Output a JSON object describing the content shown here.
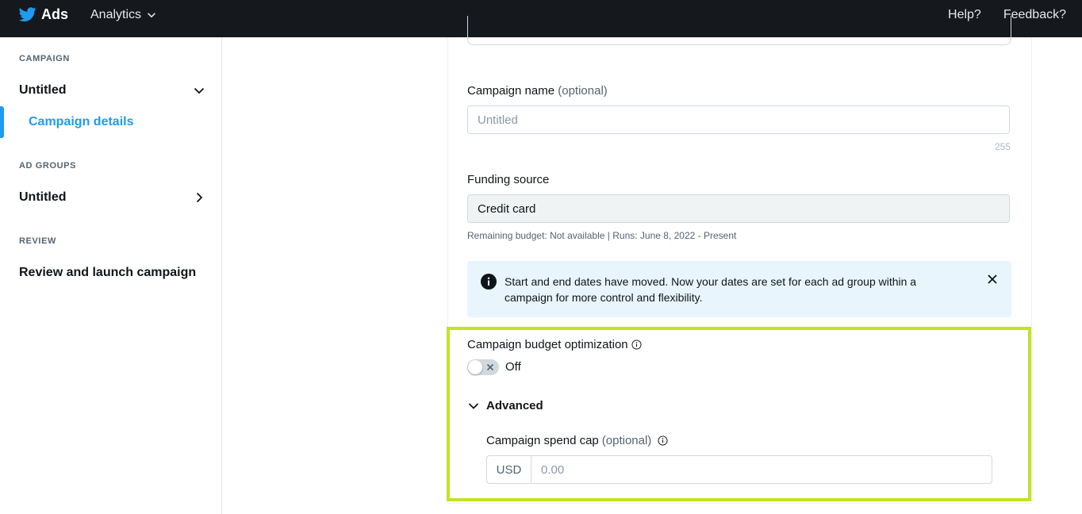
{
  "topbar": {
    "brand": "Ads",
    "analytics_label": "Analytics",
    "help_label": "Help?",
    "feedback_label": "Feedback?"
  },
  "sidebar": {
    "campaign_section": "CAMPAIGN",
    "campaign_name": "Untitled",
    "campaign_details": "Campaign details",
    "ad_groups_section": "AD GROUPS",
    "ad_group_name": "Untitled",
    "review_section": "REVIEW",
    "review_link": "Review and launch campaign"
  },
  "form": {
    "campaign_name_label": "Campaign name",
    "campaign_name_optional": "(optional)",
    "campaign_name_placeholder": "Untitled",
    "campaign_name_counter": "255",
    "funding_source_label": "Funding source",
    "funding_source_value": "Credit card",
    "funding_hint": "Remaining budget: Not available | Runs: June 8, 2022 - Present",
    "info_message": "Start and end dates have moved. Now your dates are set for each ad group within a campaign for more control and flexibility.",
    "cbo_label": "Campaign budget optimization",
    "cbo_state": "Off",
    "advanced_label": "Advanced",
    "spend_cap_label": "Campaign spend cap",
    "spend_cap_optional": "(optional)",
    "currency": "USD",
    "spend_cap_placeholder": "0.00"
  },
  "colors": {
    "topbar_bg": "#15181c",
    "accent_blue": "#1d9bf0",
    "highlight_border": "#c1e325",
    "info_bg": "#e8f5fd"
  },
  "icons": {
    "brand": "twitter-bird-icon",
    "dropdown": "chevron-down-icon",
    "expand": "chevron-right-icon",
    "info": "info-circle-icon",
    "close": "close-icon",
    "toggle_off": "x-icon"
  }
}
